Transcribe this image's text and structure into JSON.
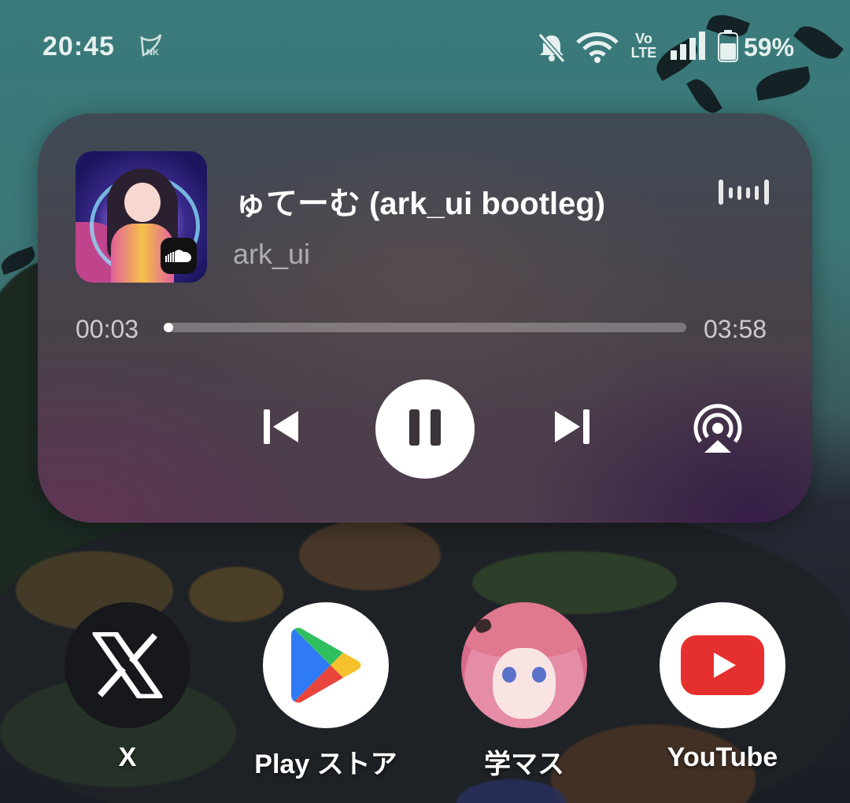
{
  "status_bar": {
    "time": "20:45",
    "battery_percent": "59%",
    "network_label_vo": "Vo",
    "network_label_lte": "LTE",
    "icons": [
      "nerv-logo-icon",
      "bell-off-icon",
      "wifi-icon",
      "volte-icon",
      "signal-icon",
      "battery-icon"
    ]
  },
  "media_player": {
    "title": "ゅてーむ (ark_ui bootleg)",
    "artist": "ark_ui",
    "source_app_icon": "soundcloud-icon",
    "elapsed": "00:03",
    "duration": "03:58",
    "progress_fraction": 0.013,
    "state": "playing",
    "controls": [
      "previous-icon",
      "pause-icon",
      "next-icon",
      "cast-icon"
    ]
  },
  "dock": {
    "apps": [
      {
        "label": "X",
        "icon": "x-icon"
      },
      {
        "label": "Play ストア",
        "icon": "play-store-icon"
      },
      {
        "label": "学マス",
        "icon": "gakumas-icon"
      },
      {
        "label": "YouTube",
        "icon": "youtube-icon"
      }
    ]
  },
  "colors": {
    "accent_white": "#ffffff",
    "youtube_red": "#e62f2f",
    "play_blue": "#2f7bf5",
    "play_green": "#2fbf5f",
    "play_yellow": "#f6c22c",
    "play_red": "#e8453c"
  }
}
